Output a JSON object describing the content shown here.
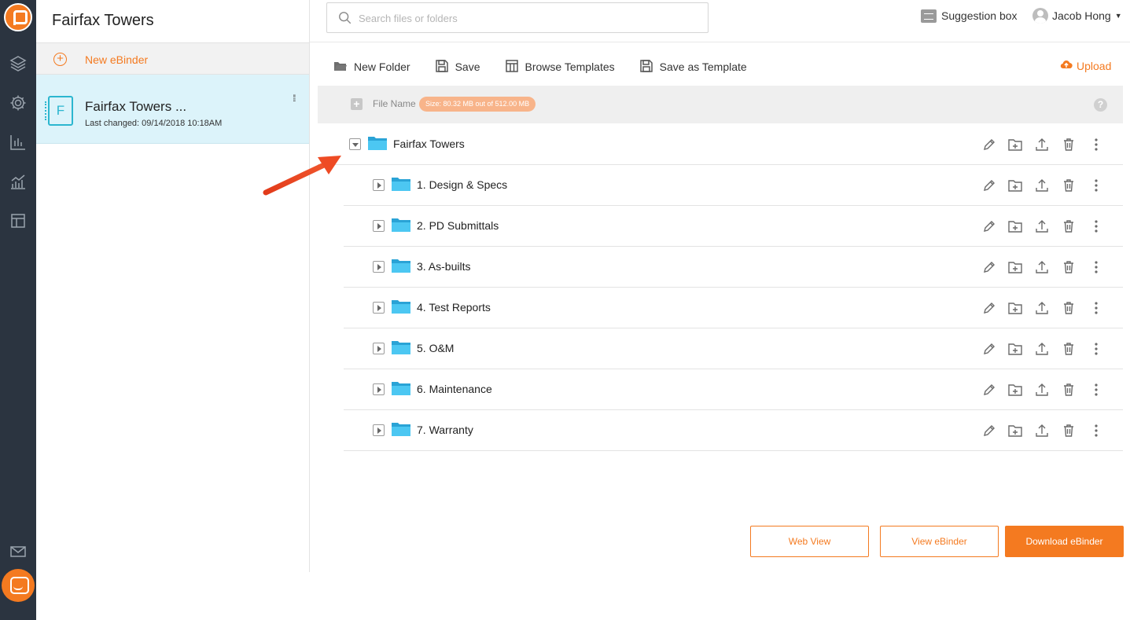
{
  "binder": {
    "title": "Fairfax Towers",
    "new_ebinder_label": "New eBinder",
    "card_name": "Fairfax Towers ...",
    "card_changed": "Last changed: 09/14/2018 10:18AM",
    "card_icon_letter": "F"
  },
  "search": {
    "placeholder": "Search files or folders"
  },
  "header": {
    "suggestion_label": "Suggestion box",
    "user_name": "Jacob Hong"
  },
  "toolbar": {
    "new_folder": "New Folder",
    "save": "Save",
    "browse_templates": "Browse Templates",
    "save_as_template": "Save as Template",
    "upload": "Upload"
  },
  "table": {
    "file_name_header": "File Name",
    "size_badge": "Size: 80.32 MB out of 512.00 MB",
    "help": "?"
  },
  "tree": {
    "root": "Fairfax Towers",
    "folders": [
      "1. Design & Specs",
      "2. PD Submittals",
      "3. As-builts",
      "4. Test Reports",
      "5. O&M",
      "6. Maintenance",
      "7. Warranty"
    ]
  },
  "buttons": {
    "web_view": "Web View",
    "view_ebinder": "View eBinder",
    "download_ebinder": "Download eBinder"
  },
  "colors": {
    "accent": "#f47a20",
    "rail": "#2b3440",
    "folder": "#3cc0ef",
    "selected": "#dcf3fa"
  }
}
